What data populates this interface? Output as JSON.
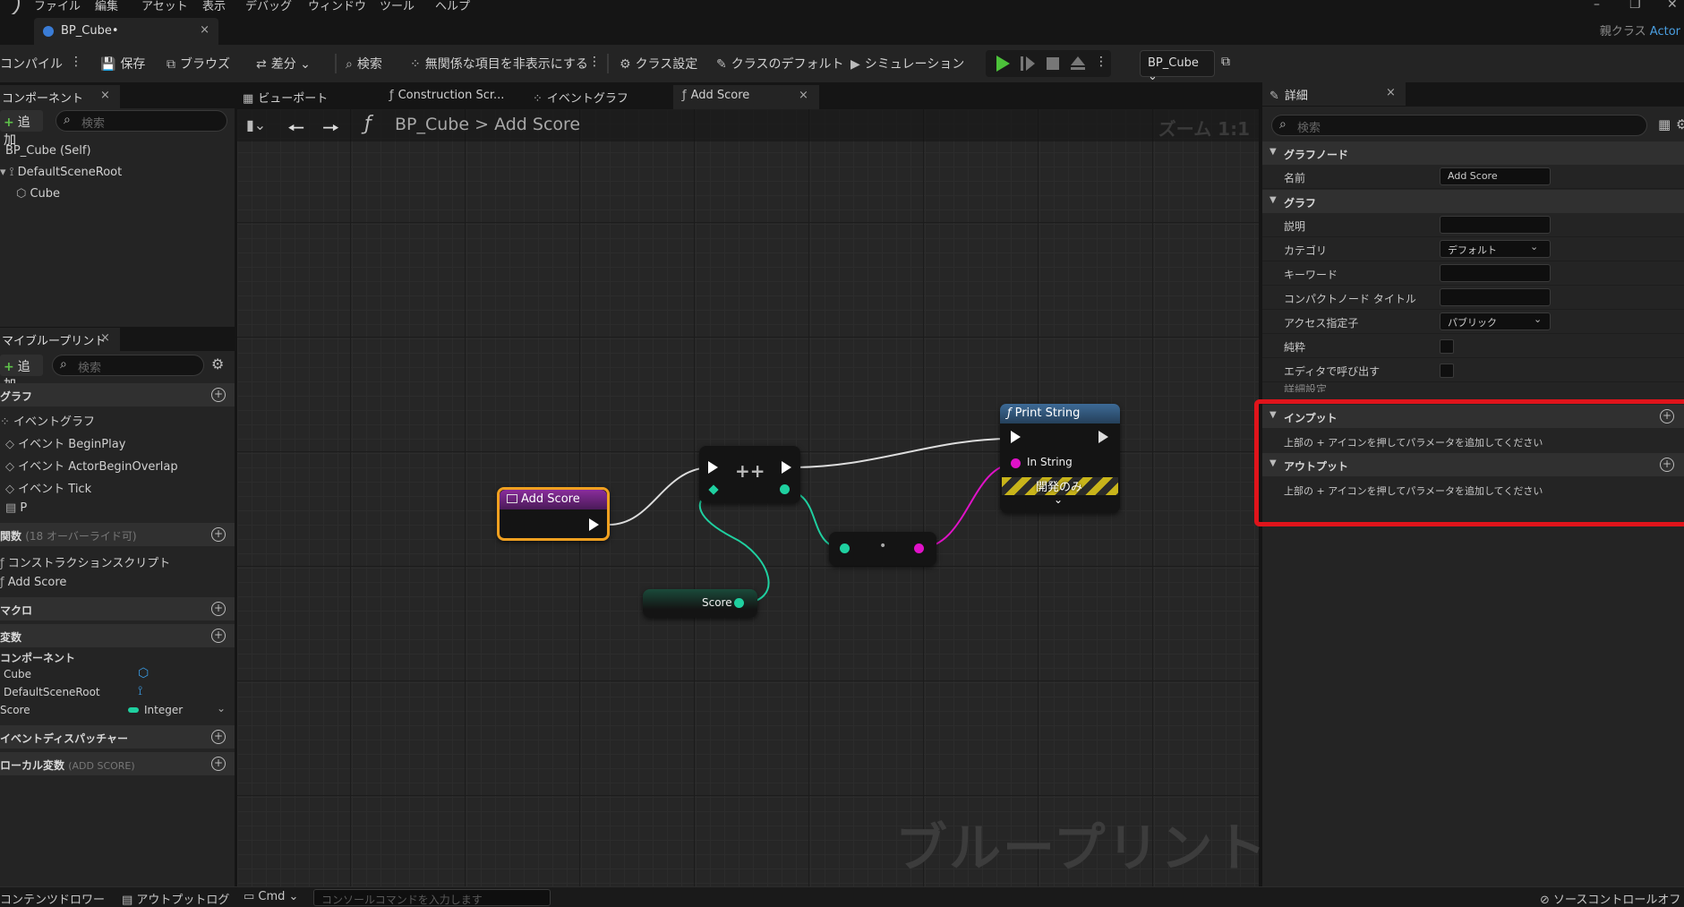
{
  "menu": [
    "ファイル",
    "編集",
    "アセット",
    "表示",
    "デバッグ",
    "ウィンドウ",
    "ツール",
    "ヘルプ"
  ],
  "window_controls": [
    "–",
    "❐",
    "✕"
  ],
  "document_tab": {
    "title": "BP_Cube•",
    "close": "×"
  },
  "parent_class": {
    "label": "親クラス",
    "value": "Actor"
  },
  "toolbar": {
    "compile": "コンパイル",
    "save": "保存",
    "browse": "ブラウズ",
    "diff": "差分",
    "find": "検索",
    "hide_unrelated": "無関係な項目を非表示にする",
    "class_settings": "クラス設定",
    "class_defaults": "クラスのデフォルト",
    "simulation": "シミュレーション",
    "debug_object": "BP_Cube"
  },
  "components_panel": {
    "tab": "コンポーネント",
    "close": "×",
    "add": "追加",
    "search_placeholder": "検索",
    "tree": [
      "BP_Cube (Self)",
      "DefaultSceneRoot",
      "Cube"
    ]
  },
  "my_blueprint": {
    "tab": "マイブループリント",
    "close": "×",
    "add": "追加",
    "search_placeholder": "検索",
    "graphs_header": "グラフ",
    "graphs": [
      "イベントグラフ",
      "イベント BeginPlay",
      "イベント ActorBeginOverlap",
      "イベント Tick",
      "P"
    ],
    "functions_header": "関数",
    "functions_note": "(18 オーバーライド可)",
    "functions": [
      "コンストラクションスクリプト",
      "Add Score"
    ],
    "macros_header": "マクロ",
    "variables_header": "変数",
    "components_group": "コンポーネント",
    "variables": [
      {
        "name": "Cube",
        "type": ""
      },
      {
        "name": "DefaultSceneRoot",
        "type": ""
      },
      {
        "name": "Score",
        "type": "Integer"
      }
    ],
    "dispatchers_header": "イベントディスパッチャー",
    "local_vars_header": "ローカル変数",
    "local_vars_note": "(ADD SCORE)"
  },
  "graph_tabs": [
    "ビューポート",
    "Construction Scr...",
    "イベントグラフ",
    "Add Score"
  ],
  "graph_tab_close": "×",
  "graph": {
    "breadcrumb_root": "BP_Cube",
    "breadcrumb_sep": ">",
    "breadcrumb_leaf": "Add Score",
    "zoom": "ズーム 1:1",
    "watermark": "ブループリント",
    "nodes": {
      "entry": "Add Score",
      "increment": "++",
      "to_string": "•",
      "score_get": "Score",
      "print_title": "Print String",
      "print_pin": "In String",
      "dev_only": "開発のみ"
    }
  },
  "details": {
    "tab": "詳細",
    "close": "×",
    "search_placeholder": "検索",
    "graph_node_section": "グラフノード",
    "name_label": "名前",
    "name_value": "Add Score",
    "graph_section": "グラフ",
    "description_label": "説明",
    "category_label": "カテゴリ",
    "category_value": "デフォルト",
    "keywords_label": "キーワード",
    "compact_title_label": "コンパクトノード タイトル",
    "access_label": "アクセス指定子",
    "access_value": "パブリック",
    "pure_label": "純粋",
    "call_in_editor_label": "エディタで呼び出す",
    "advanced_label": "詳細設定",
    "inputs_section": "インプット",
    "inputs_hint": "上部の + アイコンを押してパラメータを追加してください",
    "outputs_section": "アウトプット",
    "outputs_hint": "上部の + アイコンを押してパラメータを追加してください"
  },
  "statusbar": {
    "content_drawer": "コンテンツドロワー",
    "output_log": "アウトプットログ",
    "cmd": "Cmd",
    "console_placeholder": "コンソールコマンドを入力します",
    "source_control": "ソースコントロールオフ"
  },
  "colors": {
    "accent_blue": "#3a7cd6",
    "exec_white": "#ffffff",
    "integer_pin": "#1fd0a0",
    "string_pin": "#e012c8",
    "highlight_red": "#e0141b",
    "entry_border": "#f0a020"
  }
}
